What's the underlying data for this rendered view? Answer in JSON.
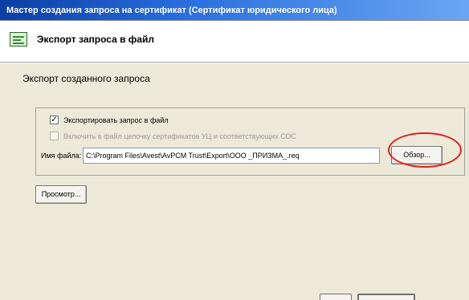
{
  "window": {
    "title": "Мастер создания запроса на сертификат (Сертификат юридического лица)"
  },
  "header": {
    "title": "Экспорт запроса в файл",
    "icon": "certificate-request-icon"
  },
  "main": {
    "section_title": "Экспорт созданного запроса",
    "export_checkbox": {
      "label": "Экспортировать запрос в файл",
      "checked": true
    },
    "chain_checkbox": {
      "label": "Включить в файл цепочку сертификатов УЦ и соответствующих СОС",
      "checked": false,
      "disabled": true
    },
    "file_name": {
      "label": "Имя файла:",
      "value": "C:\\Program Files\\Avest\\AvPCM Trust\\Export\\ООО _ПРИЗМА_.req"
    },
    "browse_button": "Обзор...",
    "preview_button": "Просмотр..."
  },
  "colors": {
    "highlight_ellipse": "#e0201f",
    "title_bar": "#0a3fa3"
  }
}
